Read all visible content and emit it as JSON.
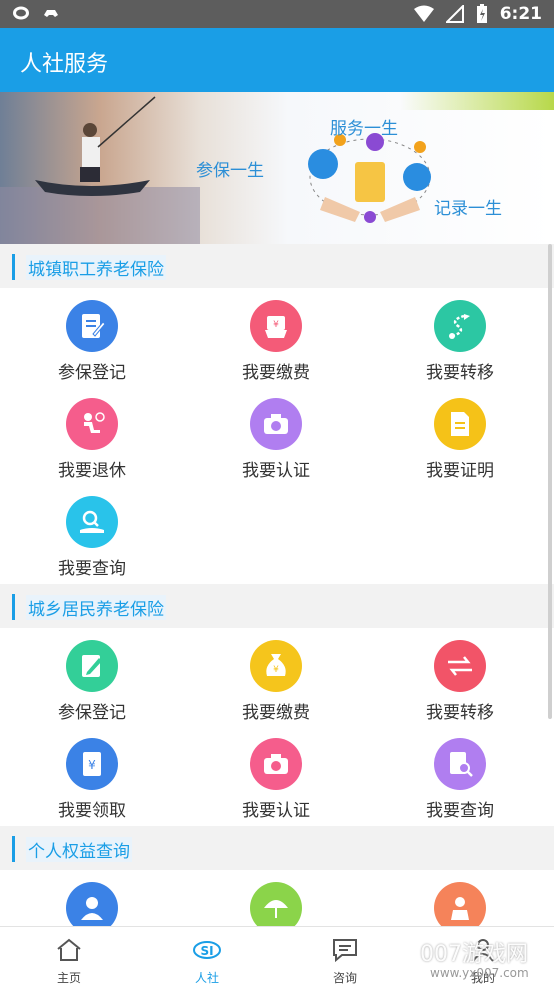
{
  "status_bar": {
    "time": "6:21"
  },
  "appbar": {
    "title": "人社服务"
  },
  "banner": {
    "text_top": "服务一生",
    "text_left": "参保一生",
    "text_right": "记录一生"
  },
  "sections": [
    {
      "title": "城镇职工养老保险",
      "items": [
        {
          "label": "参保登记",
          "icon": "form-icon",
          "color": "#3b82e6"
        },
        {
          "label": "我要缴费",
          "icon": "payment-icon",
          "color": "#f45b78"
        },
        {
          "label": "我要转移",
          "icon": "route-icon",
          "color": "#2cc7a3"
        },
        {
          "label": "我要退休",
          "icon": "retire-icon",
          "color": "#f55d8c"
        },
        {
          "label": "我要认证",
          "icon": "camera-icon",
          "color": "#b07ef0"
        },
        {
          "label": "我要证明",
          "icon": "document-icon",
          "color": "#f5c218"
        },
        {
          "label": "我要查询",
          "icon": "search-hand-icon",
          "color": "#29c3ea"
        }
      ]
    },
    {
      "title": "城乡居民养老保险",
      "items": [
        {
          "label": "参保登记",
          "icon": "edit-form-icon",
          "color": "#33cf98"
        },
        {
          "label": "我要缴费",
          "icon": "money-bag-icon",
          "color": "#f5c51c"
        },
        {
          "label": "我要转移",
          "icon": "transfer-arrows-icon",
          "color": "#f25468"
        },
        {
          "label": "我要领取",
          "icon": "receipt-icon",
          "color": "#3b82e6"
        },
        {
          "label": "我要认证",
          "icon": "camera-icon",
          "color": "#f55d8c"
        },
        {
          "label": "我要查询",
          "icon": "search-doc-icon",
          "color": "#b07ef0"
        }
      ]
    },
    {
      "title": "个人权益查询",
      "items": [
        {
          "label": "",
          "icon": "person-icon",
          "color": "#3b82e6"
        },
        {
          "label": "",
          "icon": "umbrella-icon",
          "color": "#8bd44a"
        },
        {
          "label": "",
          "icon": "worker-icon",
          "color": "#f5835a"
        }
      ]
    }
  ],
  "bottom_nav": [
    {
      "label": "主页",
      "icon": "home-icon",
      "active": false
    },
    {
      "label": "人社",
      "icon": "si-logo-icon",
      "active": true
    },
    {
      "label": "咨询",
      "icon": "message-icon",
      "active": false
    },
    {
      "label": "我的",
      "icon": "user-icon",
      "active": false
    }
  ],
  "watermark": {
    "text": "007游戏网",
    "sub": "www.yx007.com"
  }
}
